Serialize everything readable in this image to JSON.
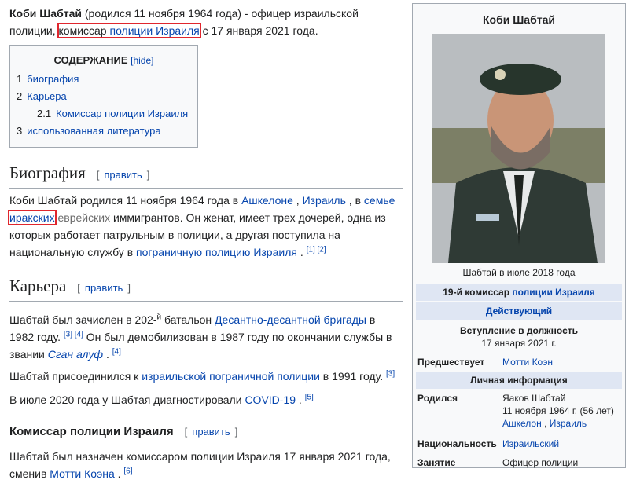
{
  "intro": {
    "name": "Коби Шабтай",
    "birth": "(родился 11 ноября 1964 года)",
    "text1": " - офицер израильской полиции, ",
    "link_commissar": "комиссар",
    "link_police": "полиции Израиля",
    "text2": " с 17 января 2021 года."
  },
  "toc": {
    "title": "СОДЕРЖАНИЕ",
    "hide": "[hide]",
    "items": [
      {
        "num": "1",
        "label": "биография"
      },
      {
        "num": "2",
        "label": "Карьера"
      },
      {
        "num": "2.1",
        "label": "Комиссар полиции Израиля"
      },
      {
        "num": "3",
        "label": "использованная литература"
      }
    ]
  },
  "edit": {
    "open": "[",
    "label": "править",
    "close": "]"
  },
  "bio": {
    "heading": "Биография",
    "t1": "Коби Шабтай родился 11 ноября 1964 года в ",
    "ashkelon": "Ашкелоне",
    "comma": " , ",
    "israel": "Израиль",
    "t2": " , в ",
    "family": "семье",
    "iraqi": "иракских",
    "t3": " еврейских",
    "t4": " иммигрантов. Он женат, имеет трех дочерей, одна из которых работает патрульным в полиции, а другая поступила на национальную службу в ",
    "border": "пограничную полицию Израиля",
    "t5": " . ",
    "refs": "[1] [2]"
  },
  "career": {
    "heading": "Карьера",
    "p1a": "Шабтай был зачислен в 202-",
    "sup_y": "й",
    "p1b": " батальон ",
    "brigade": "Десантно-десантной бригады",
    "p1c": " в 1982 году. ",
    "ref34": "[3] [4]",
    "p1d": " Он был демобилизован в 1987 году по окончании службы в звании ",
    "rank": "Сган алуф",
    "p1e": " . ",
    "ref4": "[4]",
    "p2a": "Шабтай присоединился к ",
    "border_police": "израильской пограничной полиции",
    "p2b": " в 1991 году. ",
    "ref3": "[3]",
    "p3a": "В июле 2020 года у Шабтая диагностировали ",
    "covid": "COVID-19",
    "p3b": " . ",
    "ref5": "[5]"
  },
  "commissioner": {
    "heading": "Комиссар полиции Израиля",
    "p1": "Шабтай был назначен комиссаром полиции Израиля 17 января 2021 года, сменив ",
    "motti": "Мотти Коэна",
    "p2": " . ",
    "ref6": "[6]"
  },
  "infobox": {
    "title": "Коби Шабтай",
    "caption": "Шабтай в июле 2018 года",
    "band1_pre": "19-й комиссар ",
    "band1_link": "полиции Израиля",
    "band2": "Действующий",
    "assumed_label": "Вступление в должность",
    "assumed_date": "17 января 2021 г.",
    "predecessor_label": "Предшествует",
    "predecessor": "Мотти Коэн",
    "personal": "Личная информация",
    "born_label": "Родился",
    "born_name": "Яаков Шабтай",
    "born_date": "11 ноября 1964 г. (56 лет)",
    "born_city": "Ашкелон",
    "born_sep": " , ",
    "born_country": "Израиль",
    "nationality_label": "Национальность",
    "nationality": "Израильский",
    "occupation_label": "Занятие",
    "occupation": "Офицер полиции"
  },
  "colors": {
    "link": "#0645ad",
    "highlight": "#e0262d",
    "band": "#dfe6f3"
  }
}
